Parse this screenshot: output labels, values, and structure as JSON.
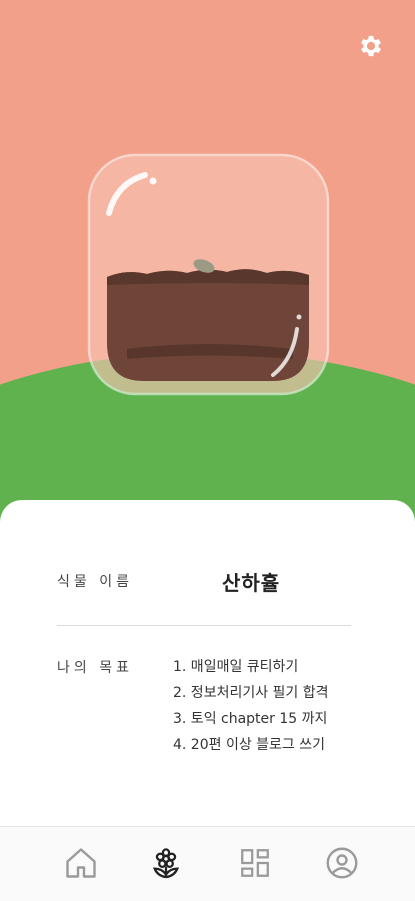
{
  "plant": {
    "name_label": "식물 이름",
    "name": "산하휼"
  },
  "goals": {
    "label": "나의 목표",
    "items": [
      "1. 매일매일 큐티하기",
      "2. 정보처리기사 필기 합격",
      "3. 토익 chapter 15 까지",
      "4. 20편 이상 블로그 쓰기"
    ]
  },
  "nav": {
    "items": [
      {
        "icon": "home-icon",
        "active": false
      },
      {
        "icon": "flower-icon",
        "active": true
      },
      {
        "icon": "dashboard-icon",
        "active": false
      },
      {
        "icon": "profile-icon",
        "active": false
      }
    ]
  },
  "colors": {
    "sky": "#f2a089",
    "hill": "#5fb24d",
    "soil": "#6e4538",
    "active_icon": "#222222",
    "inactive_icon": "#9a9a9a"
  }
}
